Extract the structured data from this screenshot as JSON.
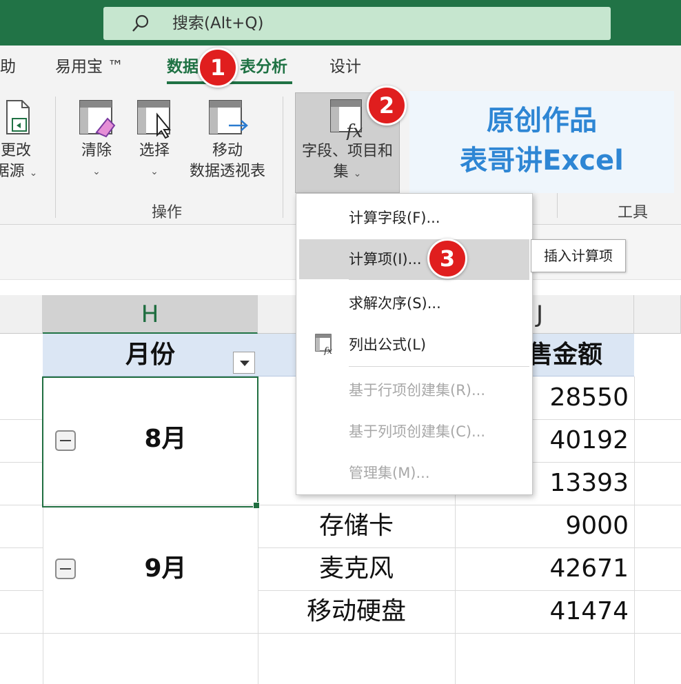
{
  "search": {
    "placeholder": "搜索(Alt+Q)"
  },
  "tabs": [
    {
      "label": "助"
    },
    {
      "label": "易用宝 ™"
    },
    {
      "label": "数据"
    },
    {
      "label": "表分析"
    },
    {
      "label": "设计"
    }
  ],
  "ribbon": {
    "change_source": {
      "line1": "更改",
      "line2": "据源",
      "chevron": "⌄"
    },
    "clear": {
      "label": "清除",
      "chevron": "⌄"
    },
    "select": {
      "label": "选择",
      "chevron": "⌄"
    },
    "move": {
      "line1": "移动",
      "line2": "数据透视表"
    },
    "fields_items": {
      "line1": "字段、项目和",
      "line2": "集",
      "chevron": "⌄"
    },
    "group_operation": "操作",
    "group_tools": "工具"
  },
  "watermark": {
    "line1": "原创作品",
    "line2": "表哥讲Excel"
  },
  "menu": {
    "items": [
      {
        "label": "计算字段(F)...",
        "state": "normal"
      },
      {
        "label": "计算项(I)...",
        "state": "hover"
      },
      {
        "label": "求解次序(S)...",
        "state": "normal"
      },
      {
        "label": "列出公式(L)",
        "state": "normal",
        "icon": "list-formulas-icon"
      },
      {
        "label": "基于行项创建集(R)...",
        "state": "disabled"
      },
      {
        "label": "基于列项创建集(C)...",
        "state": "disabled"
      },
      {
        "label": "管理集(M)...",
        "state": "disabled"
      }
    ],
    "tooltip": "插入计算项"
  },
  "badges": [
    "1",
    "2",
    "3"
  ],
  "grid": {
    "columns": {
      "h": "H",
      "j": "J"
    },
    "header": {
      "month": "月份",
      "amount": "售金额"
    },
    "months": [
      "8月",
      "9月"
    ],
    "products": [
      "存储卡",
      "麦克风",
      "移动硬盘"
    ],
    "amounts": [
      "28550",
      "40192",
      "13393",
      "9000",
      "42671",
      "41474"
    ]
  },
  "colors": {
    "excel_green": "#217346",
    "badge_red": "#e01e1e",
    "watermark_blue": "#2e86d4"
  }
}
